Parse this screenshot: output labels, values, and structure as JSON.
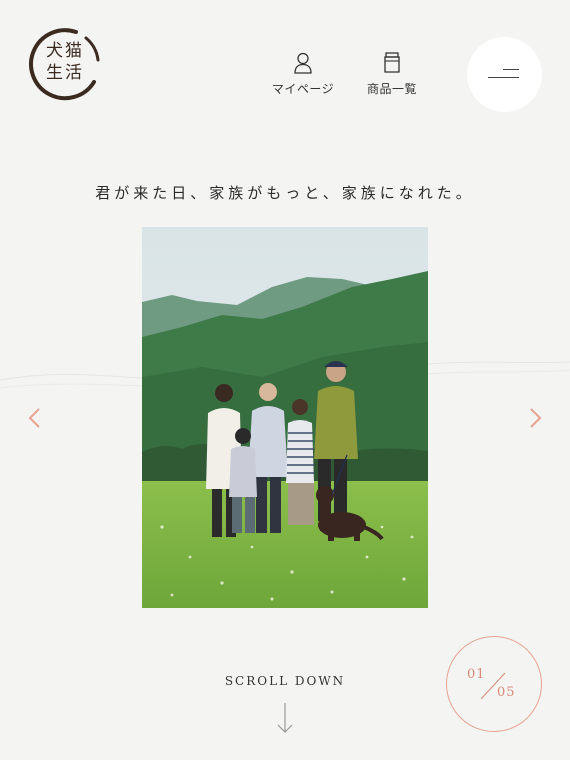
{
  "header": {
    "logo_text": "犬猫生活",
    "logo_line1": "犬猫",
    "logo_line2": "生活",
    "nav": [
      {
        "label": "マイページ",
        "icon": "person-icon"
      },
      {
        "label": "商品一覧",
        "icon": "jar-icon"
      }
    ],
    "menu_icon": "hamburger-menu-icon"
  },
  "hero": {
    "tagline": "君が来た日、家族がもっと、家族になれた。",
    "photo_description_icon": "family-photo",
    "prev_icon": "chevron-left-icon",
    "next_icon": "chevron-right-icon"
  },
  "footer": {
    "scroll_label": "SCROLL DOWN",
    "scroll_icon": "arrow-down-icon",
    "slide_current": "01",
    "slide_total": "05"
  },
  "colors": {
    "background": "#f4f4f3",
    "accent": "#e8a393",
    "logo_brown": "#3b2a20"
  }
}
